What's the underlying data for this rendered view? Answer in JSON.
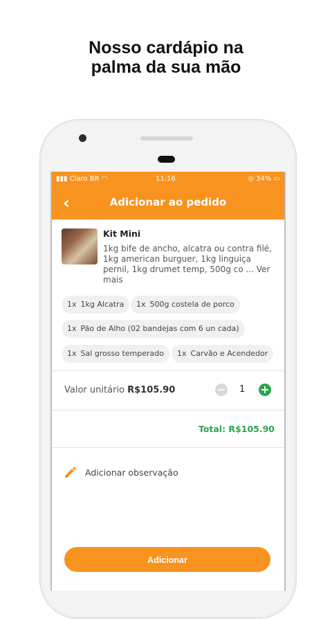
{
  "headline": {
    "line1": "Nosso cardápio na",
    "line2": "palma da sua mão"
  },
  "status_bar": {
    "carrier": "Claro BR",
    "time": "11:16",
    "battery": "34%"
  },
  "app_bar": {
    "back_icon": "chevron-left-icon",
    "title": "Adicionar ao pedido"
  },
  "product": {
    "name": "Kit Mini",
    "description": "1kg bife de ancho, alcatra ou contra filé, 1kg american burguer, 1kg linguiça pernil, 1kg drumet temp, 500g co ... Ver mais"
  },
  "items": [
    {
      "qty": "1x",
      "name": "1kg Alcatra"
    },
    {
      "qty": "1x",
      "name": "500g costela de porco"
    },
    {
      "qty": "1x",
      "name": "Pão de Alho (02 bandejas com 6 un cada)"
    },
    {
      "qty": "1x",
      "name": "Sal grosso temperado"
    },
    {
      "qty": "1x",
      "name": "Carvão e Acendedor"
    }
  ],
  "pricing": {
    "unit_label": "Valor unitário",
    "unit_price": "R$105.90",
    "quantity": "1",
    "total": "Total: R$105.90"
  },
  "observation": {
    "icon": "pencil-icon",
    "label": "Adicionar observação"
  },
  "action": {
    "add_label": "Adicionar"
  },
  "colors": {
    "accent": "#f7931e",
    "success": "#2aa54a"
  }
}
